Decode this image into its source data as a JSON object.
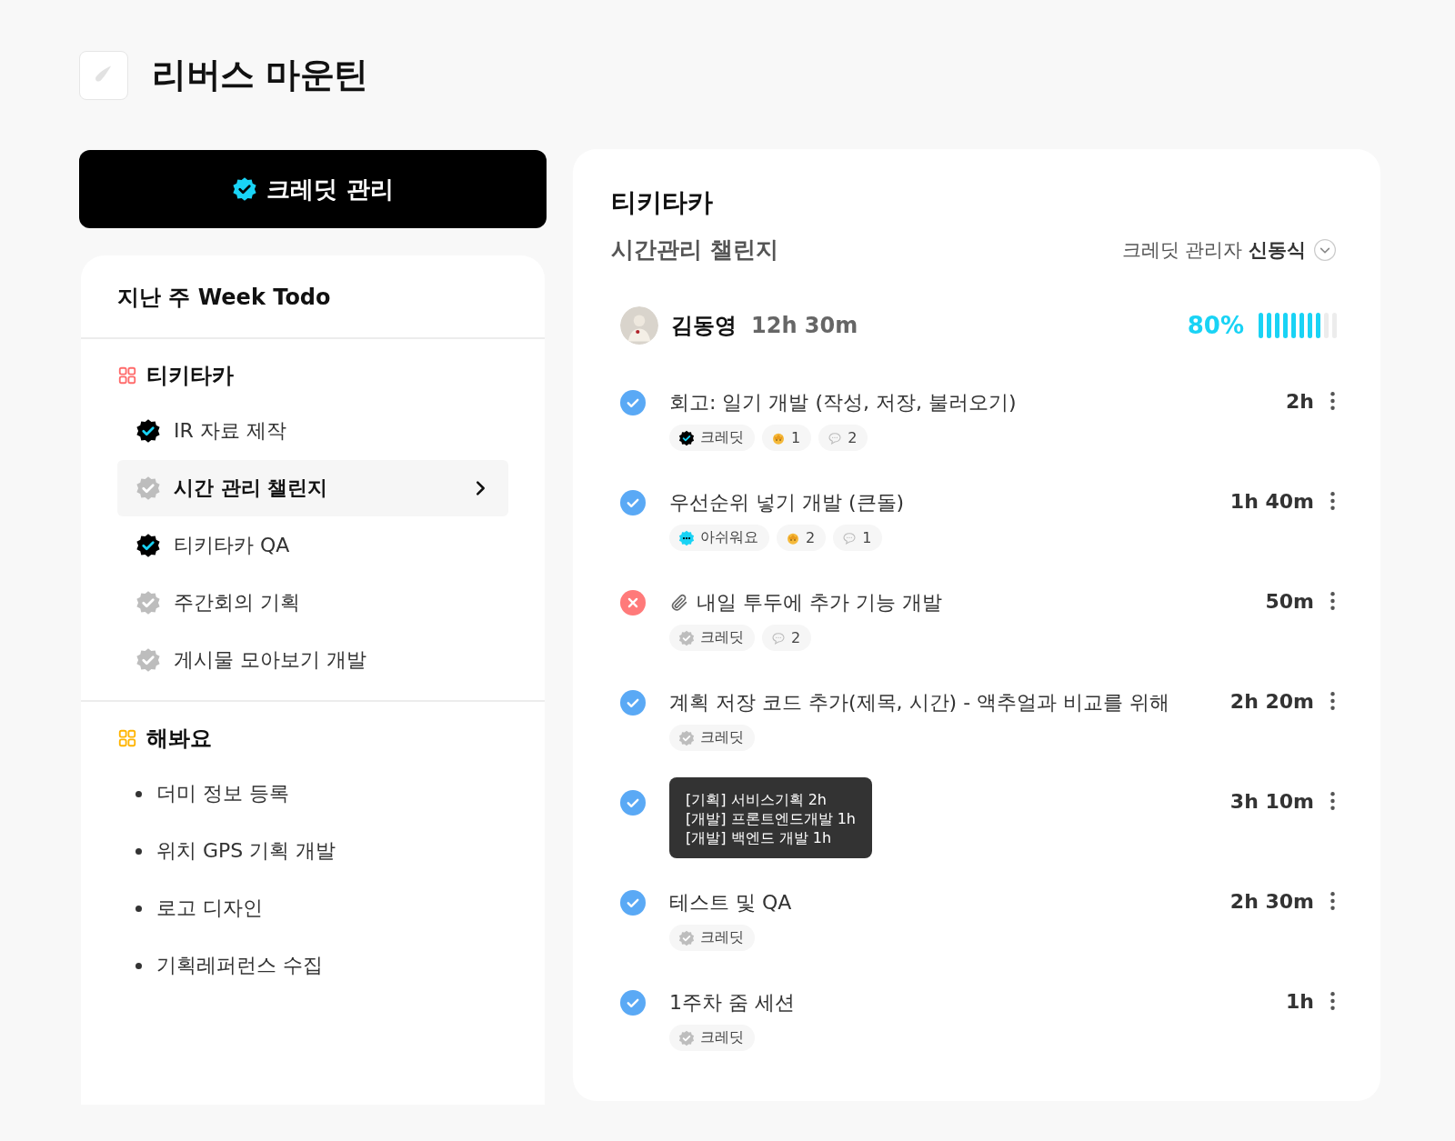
{
  "app": {
    "title": "리버스 마운틴"
  },
  "credit_button": {
    "label": "크레딧 관리"
  },
  "week_todo": {
    "title": "지난 주 Week Todo",
    "groups": [
      {
        "name": "티키타카",
        "color": "#ff6b6b",
        "kind": "badges",
        "items": [
          {
            "label": "IR 자료 제작",
            "verified": true,
            "selected": false
          },
          {
            "label": "시간 관리 챌린지",
            "verified": false,
            "selected": true
          },
          {
            "label": "티키타카 QA",
            "verified": true,
            "selected": false
          },
          {
            "label": "주간회의 기획",
            "verified": false,
            "selected": false
          },
          {
            "label": "게시물 모아보기 개발",
            "verified": false,
            "selected": false
          }
        ]
      },
      {
        "name": "해봐요",
        "color": "#ffb400",
        "kind": "bullets",
        "items": [
          {
            "label": "더미 정보 등록",
            "selected": false
          },
          {
            "label": "위치 GPS 기획 개발",
            "selected": false
          },
          {
            "label": "로고 디자인",
            "selected": false
          },
          {
            "label": "기획레퍼런스 수집",
            "selected": false
          }
        ]
      }
    ]
  },
  "detail": {
    "project": "티키타카",
    "title": "시간관리 챌린지",
    "manager_label": "크레딧 관리자",
    "manager_name": "신동식",
    "member": {
      "name": "김동영",
      "total": "12h 30m",
      "percent": "80%",
      "level": 0.8
    },
    "tasks": [
      {
        "completed": true,
        "attachment": false,
        "title": "회고: 일기 개발 (작성, 저장, 불러오기)",
        "time": "2h",
        "tags": [
          {
            "kind": "verified",
            "label": "크레딧"
          },
          {
            "kind": "reaction",
            "count": "1"
          },
          {
            "kind": "comment",
            "count": "2"
          }
        ]
      },
      {
        "completed": true,
        "attachment": false,
        "title": "우선순위 넣기 개발 (큰돌)",
        "time": "1h 40m",
        "tags": [
          {
            "kind": "regret",
            "label": "아쉬워요"
          },
          {
            "kind": "reaction",
            "count": "2"
          },
          {
            "kind": "comment",
            "count": "1"
          }
        ]
      },
      {
        "completed": false,
        "attachment": true,
        "title": "내일 투두에 추가 기능 개발",
        "time": "50m",
        "tags": [
          {
            "kind": "pending",
            "label": "크레딧"
          },
          {
            "kind": "comment",
            "count": "2"
          }
        ]
      },
      {
        "completed": true,
        "attachment": false,
        "title": "계획 저장 코드 추가(제목, 시간) - 액추얼과 비교를 위해",
        "time": "2h 20m",
        "tags": [
          {
            "kind": "pending",
            "label": "크레딧"
          }
        ]
      },
      {
        "completed": true,
        "attachment": false,
        "time": "3h 10m",
        "tooltip": [
          "[기획] 서비스기획 2h",
          "[개발] 프론트엔드개발 1h",
          "[개발] 백엔드 개발 1h"
        ]
      },
      {
        "completed": true,
        "attachment": false,
        "title": "테스트 및 QA",
        "time": "2h 30m",
        "tags": [
          {
            "kind": "pending",
            "label": "크레딧"
          }
        ]
      },
      {
        "completed": true,
        "attachment": false,
        "title": "1주차 줌 세션",
        "time": "1h",
        "tags": [
          {
            "kind": "pending",
            "label": "크레딧"
          }
        ]
      }
    ]
  }
}
